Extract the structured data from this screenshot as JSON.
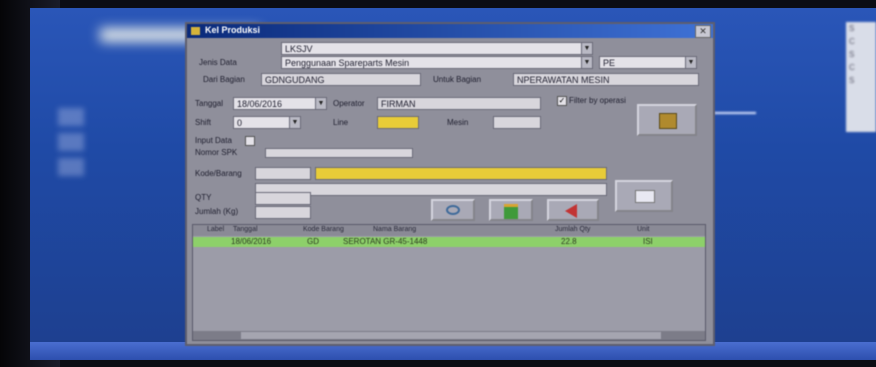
{
  "window": {
    "title": "Kel Produksi"
  },
  "form": {
    "kode_label": "",
    "kode_value": "LKSJV",
    "jenis_data_label": "Jenis Data",
    "jenis_data_value": "Penggunaan Spareparts Mesin",
    "pe_value": "PE",
    "dari_bagian_label": "Dari Bagian",
    "dari_bagian_value": "GDNGUDANG",
    "untuk_bagian_label": "Untuk Bagian",
    "untuk_bagian_value": "NPERAWATAN MESIN",
    "tanggal_label": "Tanggal",
    "tanggal_value": "18/06/2016",
    "operator_label": "Operator",
    "operator_value": "FIRMAN",
    "filter_label": "Filter by operasi",
    "filter_checked": "✓",
    "shift_label": "Shift",
    "shift_value": "0",
    "line_label": "Line",
    "mesin_label": "Mesin",
    "input_data_label": "Input Data",
    "nomor_spk_label": "Nomor SPK",
    "kode_barang_label": "Kode/Barang",
    "qty_label": "QTY",
    "jumlah_label": "Jumlah (Kg)"
  },
  "grid": {
    "headers": [
      "Label",
      "Tanggal",
      "Kode Barang",
      "Nama Barang",
      "Jumlah Qty",
      "Unit"
    ],
    "rows": [
      [
        "",
        "18/06/2016",
        "GD",
        "SEROTAN GR-45-1448",
        "22.8",
        "ISI"
      ]
    ]
  },
  "desktop": {
    "right_panel_text": [
      "S",
      "C",
      "S",
      "C",
      "S"
    ]
  },
  "icons": {
    "save": "save-icon",
    "refresh": "refresh-icon",
    "exit": "exit-icon",
    "print": "print-icon"
  }
}
